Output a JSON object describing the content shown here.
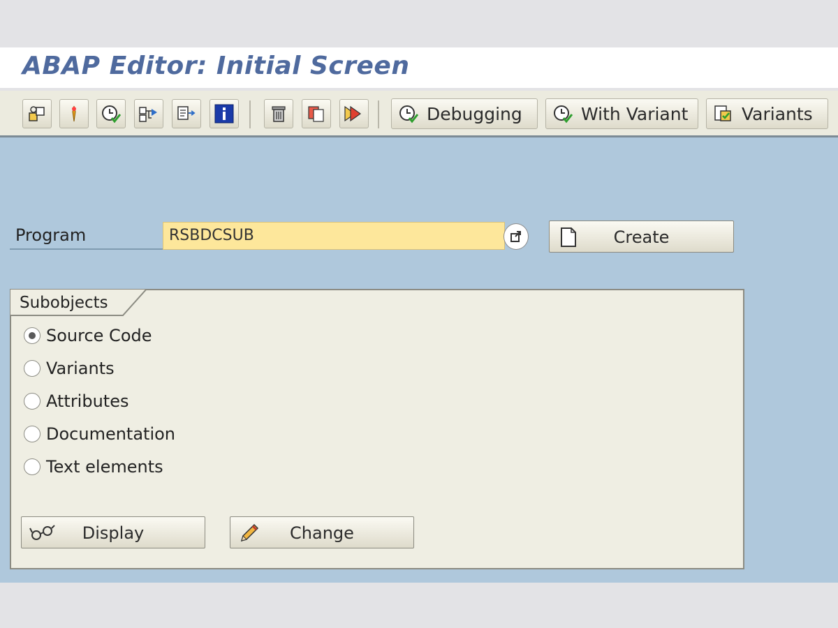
{
  "window": {
    "title": "ABAP Editor: Initial Screen"
  },
  "toolbar": {
    "icons": [
      "other-object-icon",
      "where-used-list-icon",
      "execute-icon",
      "check-icon",
      "activate-icon",
      "info-icon",
      "delete-icon",
      "copy-icon",
      "rename-icon"
    ],
    "debugging_label": "Debugging",
    "with_variant_label": "With Variant",
    "variants_label": "Variants"
  },
  "program": {
    "label": "Program",
    "value": "RSBDCSUB"
  },
  "create_label": "Create",
  "subobjects": {
    "title": "Subobjects",
    "options": [
      "Source Code",
      "Variants",
      "Attributes",
      "Documentation",
      "Text elements"
    ],
    "selected": "Source Code"
  },
  "actions": {
    "display_label": "Display",
    "change_label": "Change"
  },
  "colors": {
    "title": "#4f6a9e",
    "background": "#afc8dc",
    "input_required": "#fde79b",
    "group_panel": "#efeee3"
  }
}
